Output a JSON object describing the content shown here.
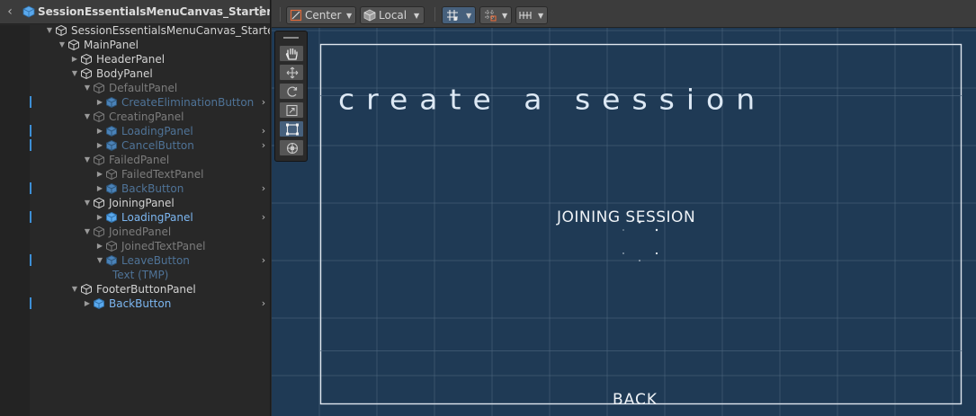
{
  "hierarchy": {
    "title": "SessionEssentialsMenuCanvas_Starter",
    "back_icon": "chevron-left-icon",
    "menu_icon": "kebab-menu-icon",
    "items": [
      {
        "label": "SessionEssentialsMenuCanvas_Starter",
        "depth": 0,
        "expanded": true,
        "style": "normal",
        "icon": "gameobject-icon",
        "chevron": false,
        "marker": false
      },
      {
        "label": "MainPanel",
        "depth": 1,
        "expanded": true,
        "style": "normal",
        "icon": "gameobject-icon",
        "chevron": false,
        "marker": false
      },
      {
        "label": "HeaderPanel",
        "depth": 2,
        "expanded": false,
        "style": "normal",
        "icon": "gameobject-icon",
        "chevron": false,
        "marker": false
      },
      {
        "label": "BodyPanel",
        "depth": 2,
        "expanded": true,
        "style": "normal",
        "icon": "gameobject-icon",
        "chevron": false,
        "marker": false
      },
      {
        "label": "DefaultPanel",
        "depth": 3,
        "expanded": true,
        "style": "dim",
        "icon": "gameobject-icon",
        "chevron": false,
        "marker": false
      },
      {
        "label": "CreateEliminationButton",
        "depth": 4,
        "expanded": false,
        "style": "prefab-dim",
        "icon": "prefab-icon",
        "chevron": true,
        "marker": true
      },
      {
        "label": "CreatingPanel",
        "depth": 3,
        "expanded": true,
        "style": "dim",
        "icon": "gameobject-icon",
        "chevron": false,
        "marker": false
      },
      {
        "label": "LoadingPanel",
        "depth": 4,
        "expanded": false,
        "style": "prefab-dim",
        "icon": "prefab-icon",
        "chevron": true,
        "marker": true
      },
      {
        "label": "CancelButton",
        "depth": 4,
        "expanded": false,
        "style": "prefab-dim",
        "icon": "prefab-icon",
        "chevron": true,
        "marker": true
      },
      {
        "label": "FailedPanel",
        "depth": 3,
        "expanded": true,
        "style": "dim",
        "icon": "gameobject-icon",
        "chevron": false,
        "marker": false
      },
      {
        "label": "FailedTextPanel",
        "depth": 4,
        "expanded": false,
        "style": "dim",
        "icon": "gameobject-icon",
        "chevron": false,
        "marker": false
      },
      {
        "label": "BackButton",
        "depth": 4,
        "expanded": false,
        "style": "prefab-dim",
        "icon": "prefab-icon",
        "chevron": true,
        "marker": true
      },
      {
        "label": "JoiningPanel",
        "depth": 3,
        "expanded": true,
        "style": "normal",
        "icon": "gameobject-icon",
        "chevron": false,
        "marker": false
      },
      {
        "label": "LoadingPanel",
        "depth": 4,
        "expanded": false,
        "style": "prefab",
        "icon": "prefab-icon",
        "chevron": true,
        "marker": true
      },
      {
        "label": "JoinedPanel",
        "depth": 3,
        "expanded": true,
        "style": "dim",
        "icon": "gameobject-icon",
        "chevron": false,
        "marker": false
      },
      {
        "label": "JoinedTextPanel",
        "depth": 4,
        "expanded": false,
        "style": "dim",
        "icon": "gameobject-icon",
        "chevron": false,
        "marker": false
      },
      {
        "label": "LeaveButton",
        "depth": 4,
        "expanded": true,
        "style": "prefab-dim",
        "icon": "prefab-icon",
        "chevron": true,
        "marker": true
      },
      {
        "label": "Text (TMP)",
        "depth": 5,
        "expanded": null,
        "style": "prefab-dim",
        "icon": "none",
        "chevron": false,
        "marker": false
      },
      {
        "label": "FooterButtonPanel",
        "depth": 2,
        "expanded": true,
        "style": "normal",
        "icon": "gameobject-icon",
        "chevron": false,
        "marker": false
      },
      {
        "label": "BackButton",
        "depth": 3,
        "expanded": false,
        "style": "prefab",
        "icon": "prefab-icon",
        "chevron": true,
        "marker": true
      }
    ]
  },
  "scene_toolbar": {
    "pivot_label": "Center",
    "space_label": "Local",
    "pivot_icon": "pivot-center-icon",
    "space_icon": "local-space-icon",
    "grid_snap_icon": "grid-snap-icon",
    "increment_snap_icon": "increment-snap-icon",
    "ruler_icon": "ruler-icon"
  },
  "tools": [
    {
      "name": "hand-tool",
      "icon": "hand-icon",
      "selected": false
    },
    {
      "name": "move-tool",
      "icon": "move-arrows-icon",
      "selected": false
    },
    {
      "name": "rotate-tool",
      "icon": "rotate-icon",
      "selected": false
    },
    {
      "name": "scale-tool",
      "icon": "scale-icon",
      "selected": false
    },
    {
      "name": "rect-tool",
      "icon": "rect-transform-icon",
      "selected": true
    },
    {
      "name": "transform-tool",
      "icon": "transform-icon",
      "selected": false
    }
  ],
  "scene": {
    "title_text": "create a session",
    "status_text": "JOINING SESSION",
    "back_text": "BACK",
    "colors": {
      "background": "#1f3a55",
      "grid": "#4e6880",
      "panel_border": "#dfe6ee",
      "text": "#e8ecf0",
      "toolbar": "#3c3c3c",
      "selected": "#46607c",
      "prefab": "#7cb6f0"
    }
  }
}
